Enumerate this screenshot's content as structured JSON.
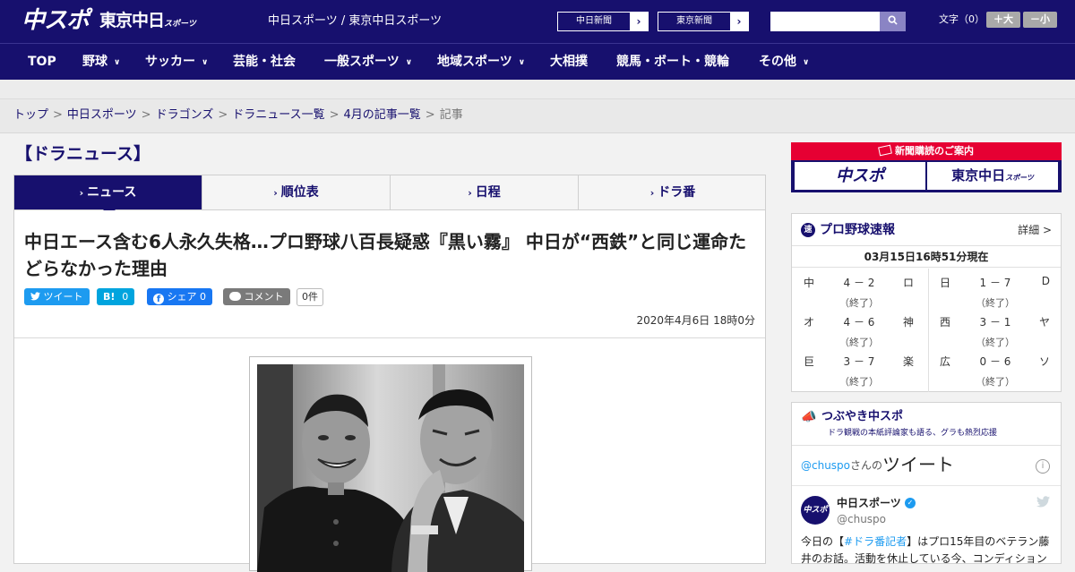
{
  "header": {
    "logo_chuspo": "中スポ",
    "logo_tokyo": "東京中日",
    "logo_tokyo_small": "スポーツ",
    "site_name": "中日スポーツ / 東京中日スポーツ",
    "links": [
      "中日新聞",
      "東京新聞"
    ],
    "search_placeholder": "",
    "font_size_label": "文字（0）",
    "font_bigger": "＋大",
    "font_smaller": "－小"
  },
  "nav": {
    "items": [
      {
        "label": "TOP",
        "dropdown": false
      },
      {
        "label": "野球",
        "dropdown": true
      },
      {
        "label": "サッカー",
        "dropdown": true
      },
      {
        "label": "芸能・社会",
        "dropdown": false
      },
      {
        "label": "一般スポーツ",
        "dropdown": true
      },
      {
        "label": "地域スポーツ",
        "dropdown": true
      },
      {
        "label": "大相撲",
        "dropdown": false
      },
      {
        "label": "競馬・ボート・競輪",
        "dropdown": false
      },
      {
        "label": "その他",
        "dropdown": true
      }
    ]
  },
  "breadcrumb": {
    "items": [
      "トップ",
      "中日スポーツ",
      "ドラゴンズ",
      "ドラニュース一覧",
      "4月の記事一覧"
    ],
    "current": "記事",
    "separator": ">"
  },
  "section_title": "【ドラニュース】",
  "tabs": [
    {
      "label": "ニュース",
      "active": true
    },
    {
      "label": "順位表",
      "active": false
    },
    {
      "label": "日程",
      "active": false
    },
    {
      "label": "ドラ番",
      "active": false
    }
  ],
  "article": {
    "title": "中日エース含む6人永久失格…プロ野球八百長疑惑『黒い霧』 中日が“西鉄”と同じ運命たどらなかった理由",
    "share": {
      "tweet": "ツイート",
      "hatena_mark": "B!",
      "hatena_count": "0",
      "facebook_label": "シェア",
      "facebook_count": "0",
      "comment": "コメント",
      "comment_count": "0件"
    },
    "date": "2020年4月6日 18時0分"
  },
  "sidebar": {
    "subscribe": {
      "header": "新聞購読のご案内",
      "logos": [
        "中スポ",
        "東京中日"
      ],
      "tokyo_small": "スポーツ"
    },
    "baseball": {
      "icon_label": "速",
      "title": "プロ野球速報",
      "detail_link": "詳細 >",
      "timestamp": "03月15日16時51分現在",
      "games": [
        {
          "home": "中",
          "score": "4 － 2",
          "away": "ロ",
          "status": "（終了）"
        },
        {
          "home": "日",
          "score": "1 － 7",
          "away": "D",
          "status": "（終了）"
        },
        {
          "home": "オ",
          "score": "4 － 6",
          "away": "神",
          "status": "（終了）"
        },
        {
          "home": "西",
          "score": "3 － 1",
          "away": "ヤ",
          "status": "（終了）"
        },
        {
          "home": "巨",
          "score": "3 － 7",
          "away": "楽",
          "status": "（終了）"
        },
        {
          "home": "広",
          "score": "0 － 6",
          "away": "ソ",
          "status": "（終了）"
        }
      ]
    },
    "tsubuyaki": {
      "title": "つぶやき中スポ",
      "subtitle": "ドラ観戦の本紙評論家も語る、グラも熱烈応援",
      "handle": "@chuspo",
      "handle_suffix": "さんの",
      "tweet_word": "ツイート",
      "info": "i",
      "tweet": {
        "avatar": "中スポ",
        "name": "中日スポーツ",
        "at": "@chuspo",
        "text_before": "今日の【",
        "hashtag": "#ドラ番記者",
        "text_after": "】はプロ15年目のベテラン藤井のお話。活動を休止している今、コンディション"
      }
    }
  }
}
